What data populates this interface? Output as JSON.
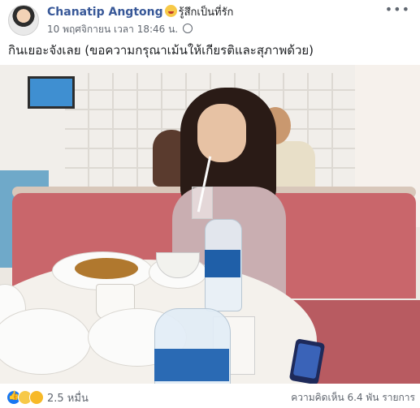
{
  "post": {
    "author_name": "Chanatip Angtong",
    "feeling": "รู้สึกเป็นที่รัก",
    "timestamp": "10 พฤศจิกายน เวลา 18:46 น.",
    "more_label": "•••",
    "text": "กินเยอะจังเลย (ขอความกรุณาเม้นให้เกียรติและสุภาพด้วย)"
  },
  "reactions": {
    "icons": [
      "like-icon",
      "haha-icon",
      "wow-icon"
    ],
    "count": "2.5 หมื่น"
  },
  "stats": {
    "comments_shares": "ความคิดเห็น 6.4 พัน รายการ"
  },
  "colors": {
    "author_blue": "#385898",
    "meta_gray": "#616770",
    "like_blue": "#1877f2"
  }
}
